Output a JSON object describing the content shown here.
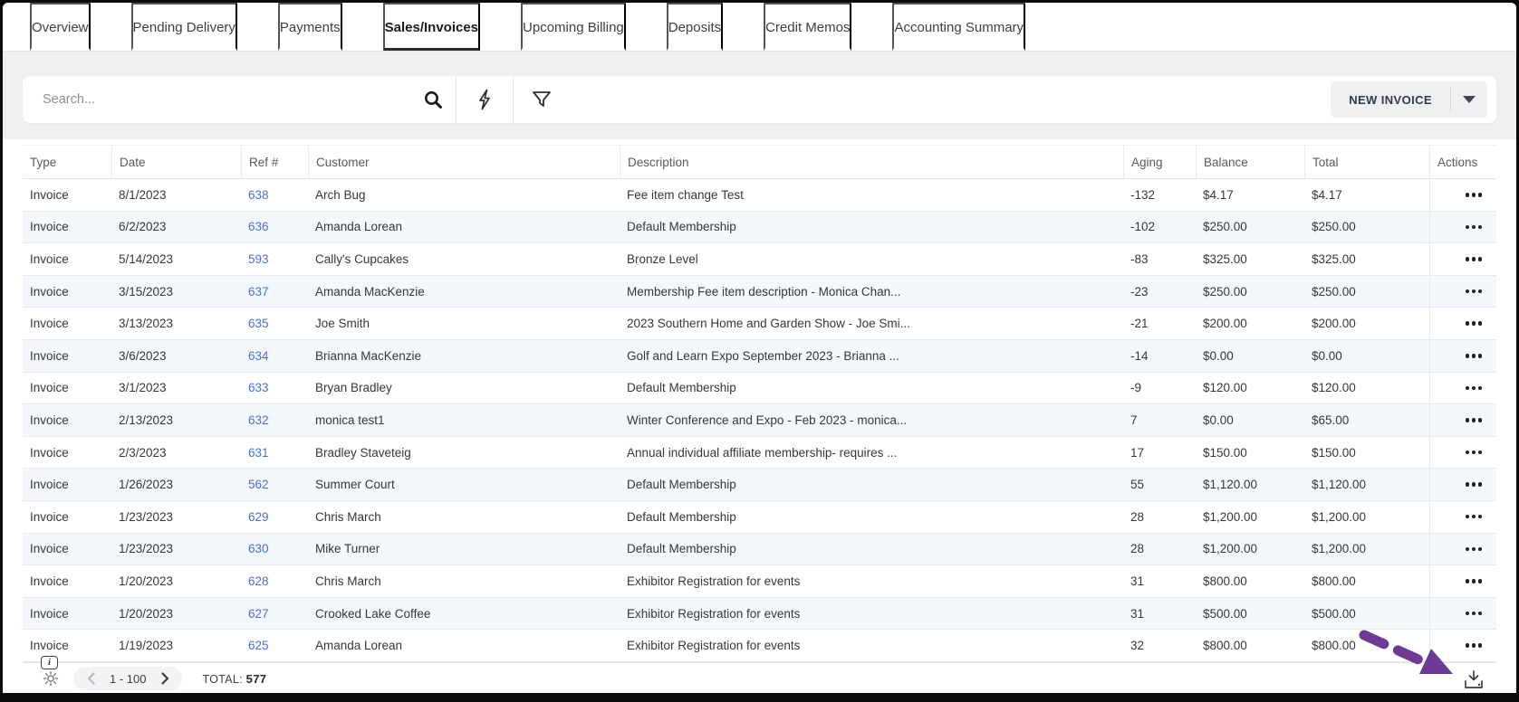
{
  "tabs": [
    {
      "label": "Overview",
      "active": false
    },
    {
      "label": "Pending Delivery",
      "active": false
    },
    {
      "label": "Payments",
      "active": false
    },
    {
      "label": "Sales/Invoices",
      "active": true
    },
    {
      "label": "Upcoming Billing",
      "active": false
    },
    {
      "label": "Deposits",
      "active": false
    },
    {
      "label": "Credit Memos",
      "active": false
    },
    {
      "label": "Accounting Summary",
      "active": false
    }
  ],
  "toolbar": {
    "search_placeholder": "Search...",
    "icons": [
      "search-icon",
      "lightning-icon",
      "filter-icon"
    ],
    "new_invoice_label": "NEW INVOICE"
  },
  "table": {
    "columns": [
      "Type",
      "Date",
      "Ref #",
      "Customer",
      "Description",
      "Aging",
      "Balance",
      "Total",
      "Actions"
    ],
    "rows": [
      {
        "type": "Invoice",
        "date": "8/1/2023",
        "ref": "638",
        "customer": "Arch Bug",
        "description": "Fee item change Test",
        "aging": "-132",
        "balance": "$4.17",
        "total": "$4.17"
      },
      {
        "type": "Invoice",
        "date": "6/2/2023",
        "ref": "636",
        "customer": "Amanda Lorean",
        "description": "Default Membership",
        "aging": "-102",
        "balance": "$250.00",
        "total": "$250.00"
      },
      {
        "type": "Invoice",
        "date": "5/14/2023",
        "ref": "593",
        "customer": "Cally's Cupcakes",
        "description": "Bronze Level",
        "aging": "-83",
        "balance": "$325.00",
        "total": "$325.00"
      },
      {
        "type": "Invoice",
        "date": "3/15/2023",
        "ref": "637",
        "customer": "Amanda MacKenzie",
        "description": "Membership Fee item description - Monica Chan...",
        "aging": "-23",
        "balance": "$250.00",
        "total": "$250.00"
      },
      {
        "type": "Invoice",
        "date": "3/13/2023",
        "ref": "635",
        "customer": "Joe Smith",
        "description": "2023 Southern Home and Garden Show - Joe Smi...",
        "aging": "-21",
        "balance": "$200.00",
        "total": "$200.00"
      },
      {
        "type": "Invoice",
        "date": "3/6/2023",
        "ref": "634",
        "customer": "Brianna MacKenzie",
        "description": "Golf and Learn Expo September 2023 - Brianna ...",
        "aging": "-14",
        "balance": "$0.00",
        "total": "$0.00"
      },
      {
        "type": "Invoice",
        "date": "3/1/2023",
        "ref": "633",
        "customer": "Bryan Bradley",
        "description": "Default Membership",
        "aging": "-9",
        "balance": "$120.00",
        "total": "$120.00"
      },
      {
        "type": "Invoice",
        "date": "2/13/2023",
        "ref": "632",
        "customer": "monica test1",
        "description": "Winter Conference and Expo - Feb 2023 - monica...",
        "aging": "7",
        "balance": "$0.00",
        "total": "$65.00"
      },
      {
        "type": "Invoice",
        "date": "2/3/2023",
        "ref": "631",
        "customer": "Bradley Staveteig",
        "description": "Annual individual affiliate membership- requires ...",
        "aging": "17",
        "balance": "$150.00",
        "total": "$150.00"
      },
      {
        "type": "Invoice",
        "date": "1/26/2023",
        "ref": "562",
        "customer": "Summer Court",
        "description": "Default Membership",
        "aging": "55",
        "balance": "$1,120.00",
        "total": "$1,120.00"
      },
      {
        "type": "Invoice",
        "date": "1/23/2023",
        "ref": "629",
        "customer": "Chris March",
        "description": "Default Membership",
        "aging": "28",
        "balance": "$1,200.00",
        "total": "$1,200.00"
      },
      {
        "type": "Invoice",
        "date": "1/23/2023",
        "ref": "630",
        "customer": "Mike Turner",
        "description": "Default Membership",
        "aging": "28",
        "balance": "$1,200.00",
        "total": "$1,200.00"
      },
      {
        "type": "Invoice",
        "date": "1/20/2023",
        "ref": "628",
        "customer": "Chris March",
        "description": "Exhibitor Registration for events",
        "aging": "31",
        "balance": "$800.00",
        "total": "$800.00"
      },
      {
        "type": "Invoice",
        "date": "1/20/2023",
        "ref": "627",
        "customer": "Crooked Lake Coffee",
        "description": "Exhibitor Registration for events",
        "aging": "31",
        "balance": "$500.00",
        "total": "$500.00"
      },
      {
        "type": "Invoice",
        "date": "1/19/2023",
        "ref": "625",
        "customer": "Amanda Lorean",
        "description": "Exhibitor Registration for events",
        "aging": "32",
        "balance": "$800.00",
        "total": "$800.00"
      }
    ]
  },
  "footer": {
    "info_icon": "i",
    "page_range": "1 - 100",
    "total_label": "TOTAL:",
    "total_value": "577"
  },
  "colors": {
    "link_blue": "#4a6fd4",
    "row_stripe": "#f4f8fc",
    "accent_purple": "#6d3a94",
    "button_bg": "#eef0f2"
  }
}
